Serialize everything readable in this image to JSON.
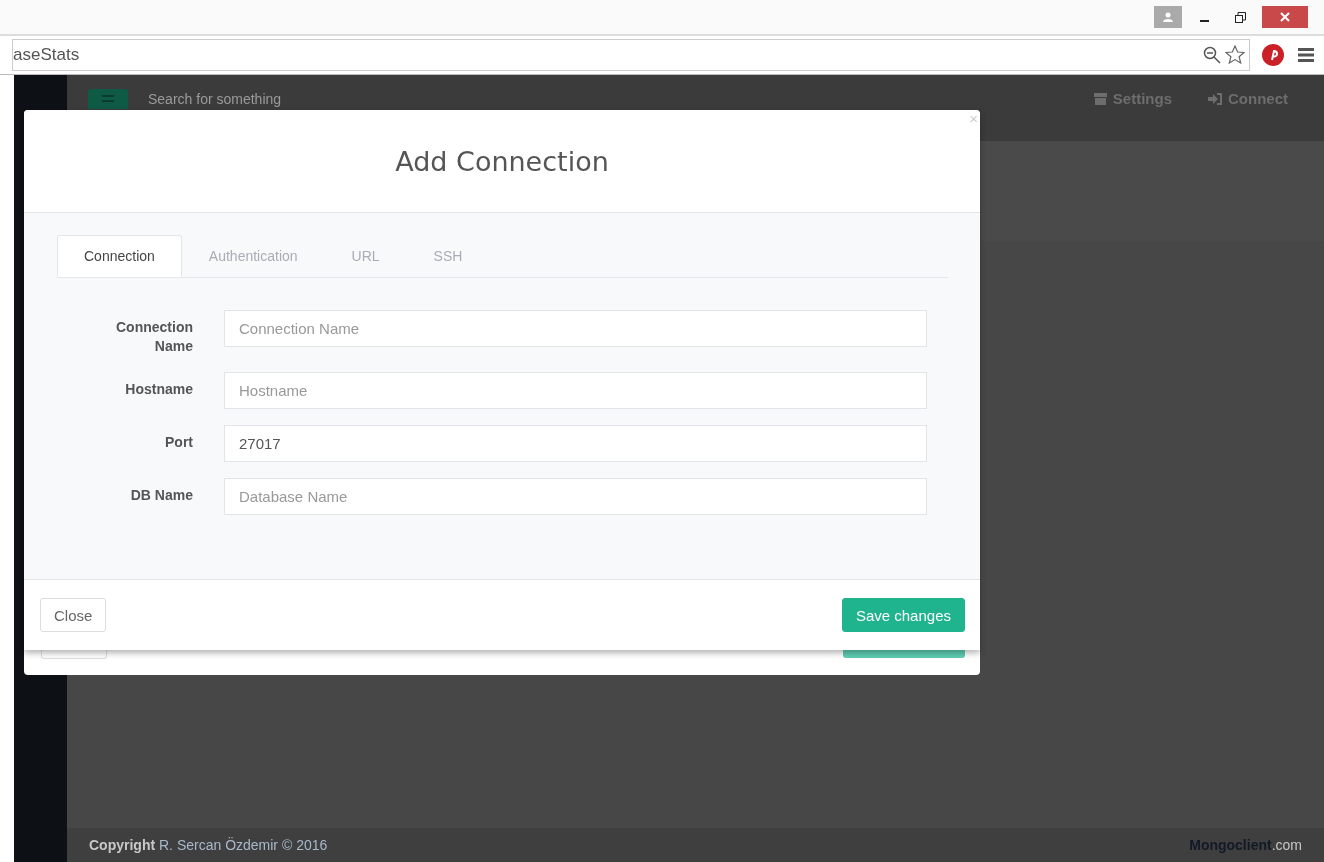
{
  "browser": {
    "address": "aseStats"
  },
  "app": {
    "header": {
      "search_placeholder": "Search for something",
      "links": [
        {
          "label": "Settings",
          "kind": "settings"
        },
        {
          "label": "Connect",
          "kind": "connect"
        }
      ]
    },
    "footer": {
      "copyright_label": "Copyright",
      "author": "R. Sercan Özdemir © 2016",
      "brand": "Mongoclient",
      "brand_suffix": ".com"
    }
  },
  "modal": {
    "title": "Add Connection",
    "close": "×",
    "tabs": [
      {
        "label": "Connection",
        "selected": true
      },
      {
        "label": "Authentication",
        "selected": false
      },
      {
        "label": "URL",
        "selected": false
      },
      {
        "label": "SSH",
        "selected": false
      }
    ],
    "fields": [
      {
        "label": "Connection Name",
        "placeholder": "Connection Name"
      },
      {
        "label": "Hostname",
        "placeholder": "Hostname"
      },
      {
        "label": "Port",
        "value": "27017"
      },
      {
        "label": "DB Name",
        "placeholder": "Database Name"
      }
    ],
    "buttons": [
      {
        "label": "Close",
        "kind": "default"
      },
      {
        "label": "Save changes",
        "kind": "primary"
      }
    ]
  }
}
